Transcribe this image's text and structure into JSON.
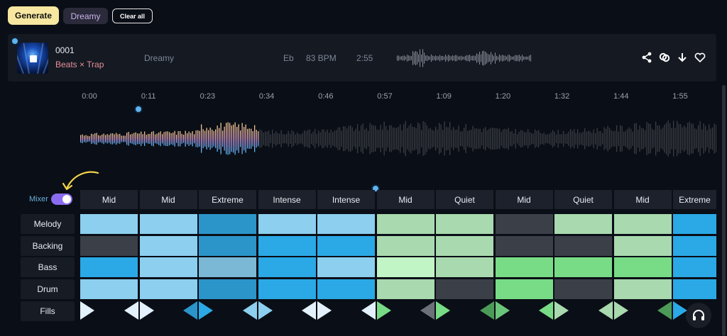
{
  "toolbar": {
    "generate_label": "Generate",
    "mood_chip": "Dreamy",
    "clear_label": "Clear all"
  },
  "track": {
    "number": "0001",
    "genre": "Beats × Trap",
    "mood": "Dreamy",
    "key": "Eb",
    "bpm": "83 BPM",
    "duration": "2:55",
    "actions": [
      "share-icon",
      "remix-icon",
      "download-icon",
      "heart-icon"
    ]
  },
  "timeline": {
    "ticks": [
      "0:00",
      "0:11",
      "0:23",
      "0:34",
      "0:46",
      "0:57",
      "1:09",
      "1:20",
      "1:32",
      "1:44",
      "1:55"
    ],
    "played_fraction": 0.28
  },
  "mixer": {
    "label": "Mixer",
    "enabled": true,
    "sections": [
      "Mid",
      "Mid",
      "Extreme",
      "Intense",
      "Intense",
      "Mid",
      "Quiet",
      "Mid",
      "Quiet",
      "Mid",
      "Extreme"
    ],
    "rows": [
      {
        "label": "Melody",
        "cells": [
          "#8ccfef",
          "#8ccfef",
          "#2b95ca",
          "#8ccfef",
          "#8ccfef",
          "#a9d9ae",
          "#a9d9ae",
          "#3a3f48",
          "#a9d9ae",
          "#a9d9ae",
          "#2aa9e6"
        ]
      },
      {
        "label": "Backing",
        "cells": [
          "#3a3f48",
          "#8ccfef",
          "#2b95ca",
          "#2aa9e6",
          "#2aa9e6",
          "#a9d9ae",
          "#a9d9ae",
          "#3a3f48",
          "#3a3f48",
          "#a9d9ae",
          "#2aa9e6"
        ]
      },
      {
        "label": "Bass",
        "cells": [
          "#2aa9e6",
          "#8ccfef",
          "#7ab8d6",
          "#2aa9e6",
          "#8ccfef",
          "#c2f5c5",
          "#a9d9ae",
          "#78dc86",
          "#78dc86",
          "#78dc86",
          "#2aa9e6"
        ]
      },
      {
        "label": "Drum",
        "cells": [
          "#8ccfef",
          "#8ccfef",
          "#2b95ca",
          "#2aa9e6",
          "#2aa9e6",
          "#a9d9ae",
          "#3a3f48",
          "#78dc86",
          "#3a3f48",
          "#a9d9ae",
          "#2aa9e6"
        ]
      }
    ],
    "fills_label": "Fills",
    "fills": [
      [
        "",
        "#e2f1fb"
      ],
      [
        "#e2f1fb",
        "#e2f1fb"
      ],
      [
        "#2a95ca",
        "#2aa9e6"
      ],
      [
        "#8ccfef",
        "#8ccfef"
      ],
      [
        "#e2f1fb",
        "#e2f1fb"
      ],
      [
        "#e2f1fb",
        "#78dc86"
      ],
      [
        "#6b7079",
        "#78dc86"
      ],
      [
        "#4c9a58",
        "#6bc57a"
      ],
      [
        "#78dc86",
        "#a9d9ae"
      ],
      [
        "#a9d9ae",
        "#a9d9ae"
      ],
      [
        "#4c9a58",
        "#2aa9e6"
      ]
    ]
  },
  "colors": {
    "accent_yellow": "#f7e7a0",
    "played_wave_top": "#f0c48a",
    "played_wave_bottom": "#56b4f0",
    "unplayed_wave": "#3a3d44"
  }
}
